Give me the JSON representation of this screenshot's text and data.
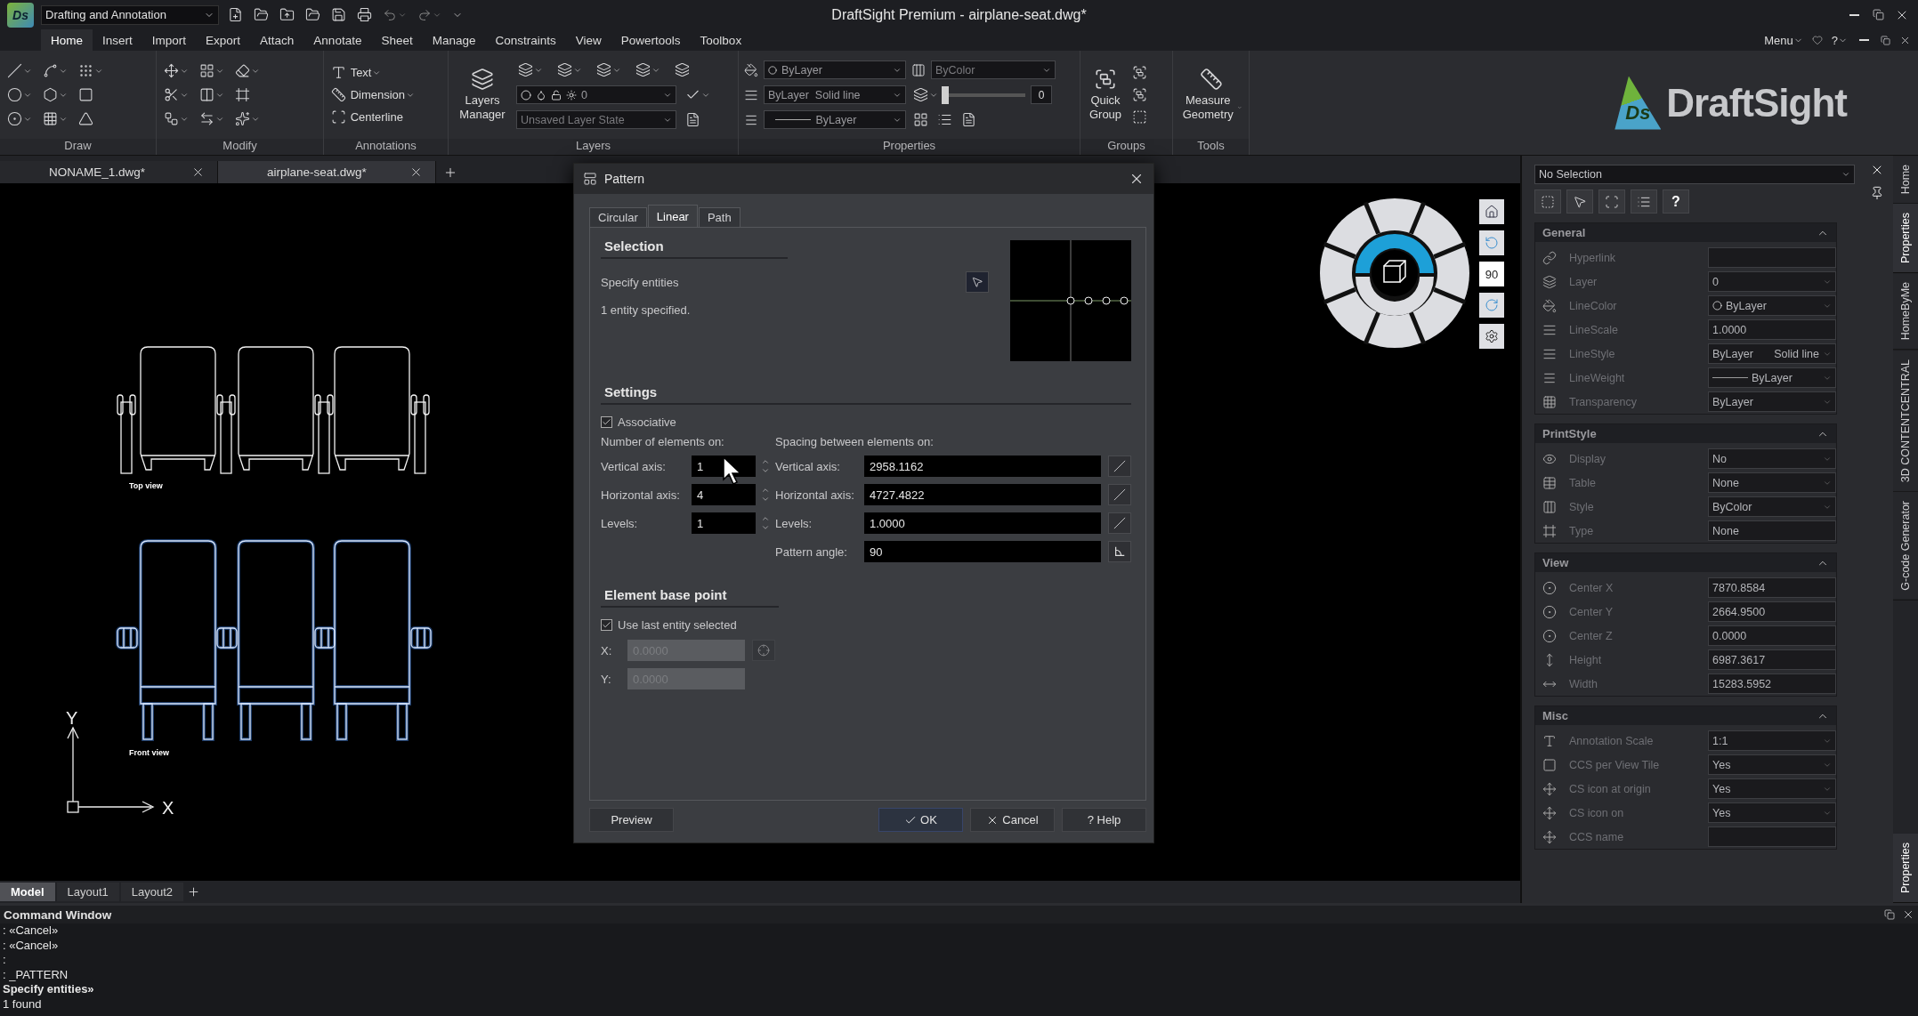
{
  "app": {
    "logo": "Ds",
    "workspace": "Drafting and Annotation",
    "title": "DraftSight Premium - airplane-seat.dwg*"
  },
  "menu_tabs": [
    {
      "label": "Home",
      "selected": true
    },
    {
      "label": "Insert",
      "selected": false
    },
    {
      "label": "Import",
      "selected": false
    },
    {
      "label": "Export",
      "selected": false
    },
    {
      "label": "Attach",
      "selected": false
    },
    {
      "label": "Annotate",
      "selected": false
    },
    {
      "label": "Sheet",
      "selected": false
    },
    {
      "label": "Manage",
      "selected": false
    },
    {
      "label": "Constraints",
      "selected": false
    },
    {
      "label": "View",
      "selected": false
    },
    {
      "label": "Powertools",
      "selected": false
    },
    {
      "label": "Toolbox",
      "selected": false
    }
  ],
  "menu_right": {
    "label": "Menu",
    "help": "?"
  },
  "ribbon": {
    "groups": [
      {
        "kind": "draw",
        "label": "Draw"
      },
      {
        "kind": "modify",
        "label": "Modify"
      },
      {
        "kind": "annotations",
        "label": "Annotations",
        "tools": [
          "Text",
          "Dimension",
          "Centerline"
        ]
      },
      {
        "kind": "layers",
        "label": "Layers",
        "manager": "Layers Manager",
        "layer": "0",
        "layer_state": "Unsaved Layer State"
      },
      {
        "kind": "properties",
        "label": "Properties",
        "line_color": "ByLayer",
        "line_style": "ByLayer",
        "line_style_name": "Solid line",
        "line_weight": "ByLayer",
        "print_style": "ByColor",
        "transparency": "0",
        "level": 0
      },
      {
        "kind": "groups",
        "label": "Groups",
        "tool": "Quick Group"
      },
      {
        "kind": "tools",
        "label": "Tools",
        "tool": "Measure Geometry"
      }
    ],
    "brand": {
      "mark": "Ds",
      "name": "DraftSight"
    }
  },
  "doc_tabs": [
    {
      "label": "NONAME_1.dwg*",
      "selected": false
    },
    {
      "label": "airplane-seat.dwg*",
      "selected": true
    }
  ],
  "canvas": {
    "labels": [
      "Top view",
      "Front view"
    ],
    "axis_x": "X",
    "axis_y": "Y",
    "view_angle": "90"
  },
  "layout_tabs": [
    {
      "label": "Model",
      "selected": true
    },
    {
      "label": "Layout1",
      "selected": false
    },
    {
      "label": "Layout2",
      "selected": false
    }
  ],
  "dialog": {
    "title": "Pattern",
    "tabs": [
      {
        "label": "Circular",
        "selected": false
      },
      {
        "label": "Linear",
        "selected": true
      },
      {
        "label": "Path",
        "selected": false
      }
    ],
    "selection": {
      "heading": "Selection",
      "prompt": "Specify entities",
      "status": "1 entity specified."
    },
    "settings": {
      "heading": "Settings",
      "associative": {
        "label": "Associative",
        "checked": true
      },
      "count_heading": "Number of elements on:",
      "spacing_heading": "Spacing between elements on:",
      "counts": [
        {
          "label": "Vertical axis:",
          "value": "1"
        },
        {
          "label": "Horizontal axis:",
          "value": "4"
        },
        {
          "label": "Levels:",
          "value": "1"
        }
      ],
      "spacings": [
        {
          "label": "Vertical axis:",
          "value": "2958.1162",
          "kind": "distance"
        },
        {
          "label": "Horizontal axis:",
          "value": "4727.4822",
          "kind": "distance"
        },
        {
          "label": "Levels:",
          "value": "1.0000",
          "kind": "distance"
        },
        {
          "label": "Pattern angle:",
          "value": "90",
          "kind": "angle"
        }
      ]
    },
    "base_point": {
      "heading": "Element base point",
      "use_last": {
        "label": "Use last entity selected",
        "checked": true
      },
      "coords": [
        {
          "label": "X:",
          "value": "0.0000",
          "disabled": true
        },
        {
          "label": "Y:",
          "value": "0.0000",
          "disabled": true
        }
      ]
    },
    "buttons": [
      {
        "label": "Preview",
        "kind": "plain"
      },
      {
        "label": "OK",
        "kind": "ok"
      },
      {
        "label": "Cancel",
        "kind": "cancel"
      },
      {
        "label": "? Help",
        "kind": "help"
      }
    ]
  },
  "properties_panel": {
    "selection": "No Selection",
    "help": "?",
    "sections": [
      {
        "title": "General",
        "expanded": true,
        "rows": [
          {
            "label": "Hyperlink",
            "kind": "field"
          },
          {
            "label": "Layer",
            "value": "0",
            "kind": "dropdown"
          },
          {
            "label": "LineColor",
            "value": "ByLayer",
            "kind": "color"
          },
          {
            "label": "LineScale",
            "value": "1.0000",
            "kind": "field"
          },
          {
            "label": "LineStyle",
            "value": "ByLayer",
            "value2": "Solid line",
            "kind": "linestyle"
          },
          {
            "label": "LineWeight",
            "value": "ByLayer",
            "kind": "lineweight"
          },
          {
            "label": "Transparency",
            "value": "ByLayer",
            "kind": "dropdown"
          }
        ]
      },
      {
        "title": "PrintStyle",
        "expanded": true,
        "rows": [
          {
            "label": "Display",
            "value": "No",
            "kind": "dropdown"
          },
          {
            "label": "Table",
            "value": "None",
            "kind": "dropdown"
          },
          {
            "label": "Style",
            "value": "ByColor",
            "kind": "dropdown"
          },
          {
            "label": "Type",
            "value": "None",
            "kind": "field"
          }
        ]
      },
      {
        "title": "View",
        "expanded": true,
        "rows": [
          {
            "label": "Center X",
            "value": "7870.8584",
            "kind": "field"
          },
          {
            "label": "Center Y",
            "value": "2664.9500",
            "kind": "field"
          },
          {
            "label": "Center Z",
            "value": "0.0000",
            "kind": "field"
          },
          {
            "label": "Height",
            "value": "6987.3617",
            "kind": "field"
          },
          {
            "label": "Width",
            "value": "15283.5952",
            "kind": "field"
          }
        ]
      },
      {
        "title": "Misc",
        "expanded": true,
        "rows": [
          {
            "label": "Annotation Scale",
            "value": "1:1",
            "kind": "dropdown"
          },
          {
            "label": "CCS per View Tile",
            "value": "Yes",
            "kind": "dropdown"
          },
          {
            "label": "CS icon at origin",
            "value": "Yes",
            "kind": "dropdown"
          },
          {
            "label": "CS icon on",
            "value": "Yes",
            "kind": "dropdown"
          },
          {
            "label": "CCS name",
            "kind": "field"
          }
        ]
      }
    ]
  },
  "side_tabs": [
    {
      "label": "Home",
      "selected": false
    },
    {
      "label": "Properties",
      "selected": true
    },
    {
      "label": "HomeByMe",
      "selected": false
    },
    {
      "label": "3D CONTENTCENTRAL",
      "selected": false
    },
    {
      "label": "G-code Generator",
      "selected": false
    }
  ],
  "side_bottom_tab": "Properties",
  "command_window": {
    "title": "Command Window",
    "lines": [
      ": «Cancel»",
      ": «Cancel»",
      ":",
      ": _PATTERN",
      "Specify entities»",
      "1 found"
    ]
  }
}
